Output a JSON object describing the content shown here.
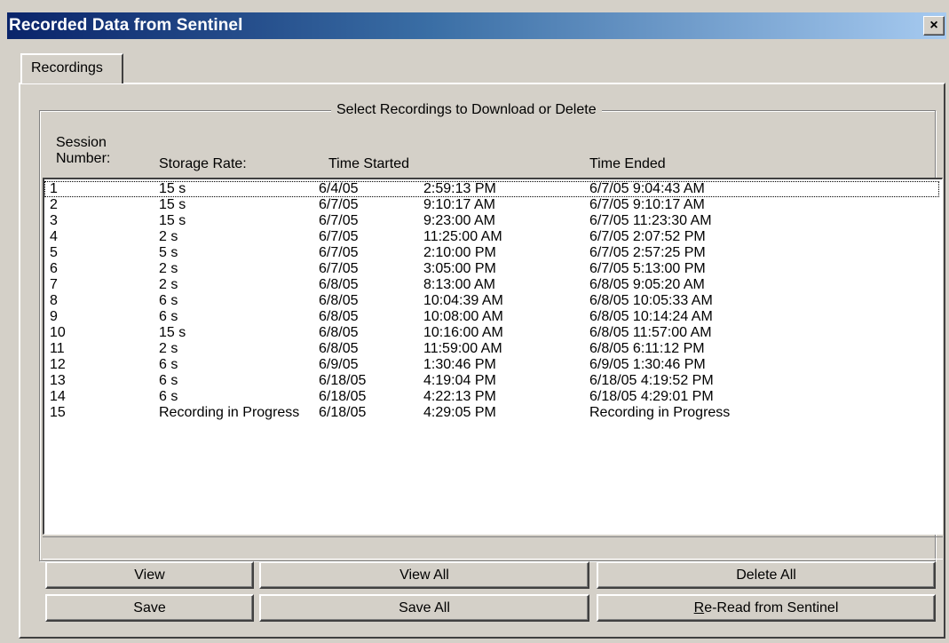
{
  "window": {
    "title": "Recorded Data from Sentinel",
    "close_glyph": "×"
  },
  "tabs": [
    {
      "label": "Recordings"
    }
  ],
  "group": {
    "label": "Select Recordings to Download or Delete"
  },
  "columns": {
    "session": [
      "Session",
      "Number:"
    ],
    "storage_rate": "Storage Rate:",
    "time_started": "Time Started",
    "time_ended": "Time Ended"
  },
  "recordings": [
    {
      "session": "1",
      "rate": "15 s",
      "start_date": "6/4/05",
      "start_time": "2:59:13 PM",
      "ended": "6/7/05 9:04:43 AM"
    },
    {
      "session": "2",
      "rate": "15 s",
      "start_date": "6/7/05",
      "start_time": "9:10:17 AM",
      "ended": "6/7/05 9:10:17 AM"
    },
    {
      "session": "3",
      "rate": "15 s",
      "start_date": "6/7/05",
      "start_time": "9:23:00 AM",
      "ended": "6/7/05 11:23:30 AM"
    },
    {
      "session": "4",
      "rate": "2 s",
      "start_date": "6/7/05",
      "start_time": "11:25:00 AM",
      "ended": "6/7/05 2:07:52 PM"
    },
    {
      "session": "5",
      "rate": "5 s",
      "start_date": "6/7/05",
      "start_time": "2:10:00 PM",
      "ended": "6/7/05 2:57:25 PM"
    },
    {
      "session": "6",
      "rate": "2 s",
      "start_date": "6/7/05",
      "start_time": "3:05:00 PM",
      "ended": "6/7/05 5:13:00 PM"
    },
    {
      "session": "7",
      "rate": "2 s",
      "start_date": "6/8/05",
      "start_time": "8:13:00 AM",
      "ended": "6/8/05 9:05:20 AM"
    },
    {
      "session": "8",
      "rate": "6 s",
      "start_date": "6/8/05",
      "start_time": "10:04:39 AM",
      "ended": "6/8/05 10:05:33 AM"
    },
    {
      "session": "9",
      "rate": "6 s",
      "start_date": "6/8/05",
      "start_time": "10:08:00 AM",
      "ended": "6/8/05 10:14:24 AM"
    },
    {
      "session": "10",
      "rate": "15 s",
      "start_date": "6/8/05",
      "start_time": "10:16:00 AM",
      "ended": "6/8/05 11:57:00 AM"
    },
    {
      "session": "11",
      "rate": "2 s",
      "start_date": "6/8/05",
      "start_time": "11:59:00 AM",
      "ended": "6/8/05 6:11:12 PM"
    },
    {
      "session": "12",
      "rate": "6 s",
      "start_date": "6/9/05",
      "start_time": "1:30:46 PM",
      "ended": "6/9/05 1:30:46 PM"
    },
    {
      "session": "13",
      "rate": "6 s",
      "start_date": "6/18/05",
      "start_time": "4:19:04 PM",
      "ended": "6/18/05 4:19:52 PM"
    },
    {
      "session": "14",
      "rate": "6 s",
      "start_date": "6/18/05",
      "start_time": "4:22:13 PM",
      "ended": "6/18/05 4:29:01 PM"
    },
    {
      "session": "15",
      "rate": "Recording in Progress",
      "start_date": "6/18/05",
      "start_time": "4:29:05 PM",
      "ended": "Recording in Progress"
    }
  ],
  "buttons": {
    "view": "View",
    "view_all": "View All",
    "delete_all": "Delete All",
    "save": "Save",
    "save_all": "Save All",
    "reread_mnemonic": "R",
    "reread_rest": "e-Read from Sentinel"
  }
}
